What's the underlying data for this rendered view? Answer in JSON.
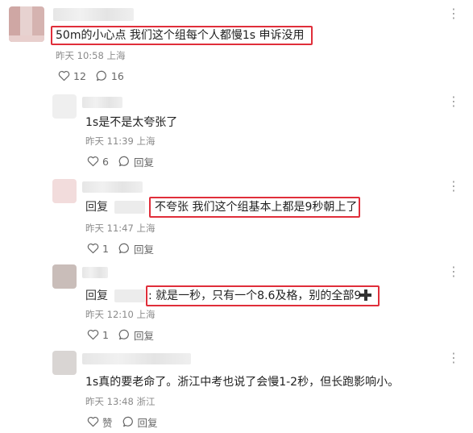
{
  "comments": [
    {
      "text": "50m的小心点 我们这个组每个人都慢1s 申诉没用",
      "time": "昨天 10:58 上海",
      "likes": "12",
      "replies": "16"
    },
    {
      "text": "1s是不是太夸张了",
      "time": "昨天 11:39 上海",
      "likes": "6",
      "reply_label": "回复"
    },
    {
      "reply_prefix": "回复",
      "text": "不夸张 我们这个组基本上都是9秒朝上了",
      "time": "昨天 11:47 上海",
      "likes": "1",
      "reply_label": "回复"
    },
    {
      "reply_prefix": "回复",
      "text": ": 就是一秒，只有一个8.6及格，别的全部9",
      "time": "昨天 12:10 上海",
      "likes": "1",
      "reply_label": "回复"
    },
    {
      "text": "1s真的要老命了。浙江中考也说了会慢1-2秒，但长跑影响小。",
      "time": "昨天 13:48 浙江",
      "likes": "赞",
      "reply_label": "回复"
    }
  ],
  "colors": {
    "highlight": "#e02e3a",
    "meta": "#8a8a8a"
  },
  "icons": [
    "heart-icon",
    "comment-icon",
    "more-icon",
    "plus-icon"
  ]
}
